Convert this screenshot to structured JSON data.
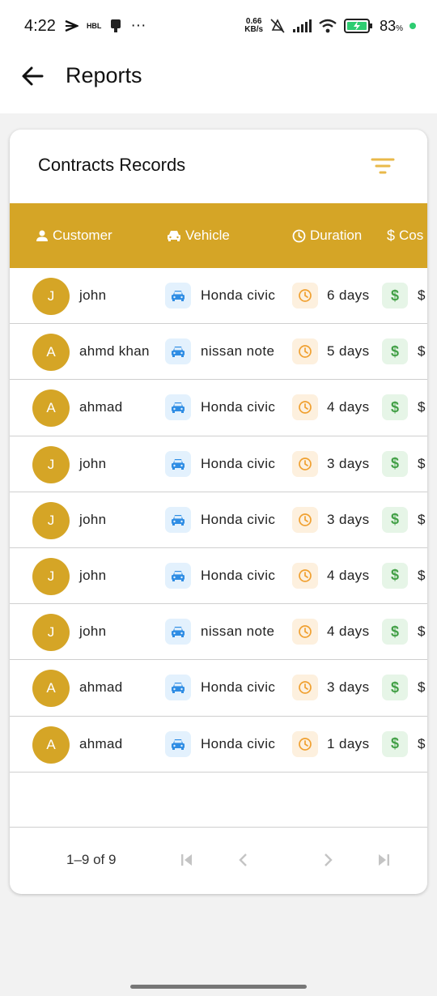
{
  "status_bar": {
    "time": "4:22",
    "carrier_badge": "HBL",
    "more": "···",
    "net_speed_value": "0.66",
    "net_speed_unit": "KB/s",
    "battery_percent": "83",
    "battery_symbol": "%"
  },
  "app_bar": {
    "title": "Reports",
    "back_icon": "arrow-left-icon"
  },
  "card": {
    "title": "Contracts Records",
    "filter_icon": "filter-icon"
  },
  "table": {
    "columns": [
      {
        "label": "Customer",
        "icon": "person-icon"
      },
      {
        "label": "Vehicle",
        "icon": "car-icon"
      },
      {
        "label": "Duration",
        "icon": "clock-icon"
      },
      {
        "label": "Cos",
        "icon": "dollar-icon"
      }
    ],
    "rows": [
      {
        "initial": "J",
        "customer": "john",
        "vehicle": "Honda civic",
        "duration": "6 days",
        "cost": "$"
      },
      {
        "initial": "A",
        "customer": "ahmd khan",
        "vehicle": "nissan note",
        "duration": "5 days",
        "cost": "$"
      },
      {
        "initial": "A",
        "customer": "ahmad",
        "vehicle": "Honda civic",
        "duration": "4 days",
        "cost": "$"
      },
      {
        "initial": "J",
        "customer": "john",
        "vehicle": "Honda civic",
        "duration": "3 days",
        "cost": "$"
      },
      {
        "initial": "J",
        "customer": "john",
        "vehicle": "Honda civic",
        "duration": "3 days",
        "cost": "$"
      },
      {
        "initial": "J",
        "customer": "john",
        "vehicle": "Honda civic",
        "duration": "4 days",
        "cost": "$"
      },
      {
        "initial": "J",
        "customer": "john",
        "vehicle": "nissan note",
        "duration": "4 days",
        "cost": "$"
      },
      {
        "initial": "A",
        "customer": "ahmad",
        "vehicle": "Honda civic",
        "duration": "3 days",
        "cost": "$"
      },
      {
        "initial": "A",
        "customer": "ahmad",
        "vehicle": "Honda civic",
        "duration": "1 days",
        "cost": "$"
      }
    ]
  },
  "pagination": {
    "info": "1–9 of 9",
    "first_icon": "first-page-icon",
    "prev_icon": "chevron-left-icon",
    "next_icon": "chevron-right-icon",
    "last_icon": "last-page-icon"
  },
  "colors": {
    "accent": "#d5a526",
    "vehicle_icon": "#2f8de4",
    "duration_icon": "#f0a030",
    "cost_icon": "#43a047"
  }
}
